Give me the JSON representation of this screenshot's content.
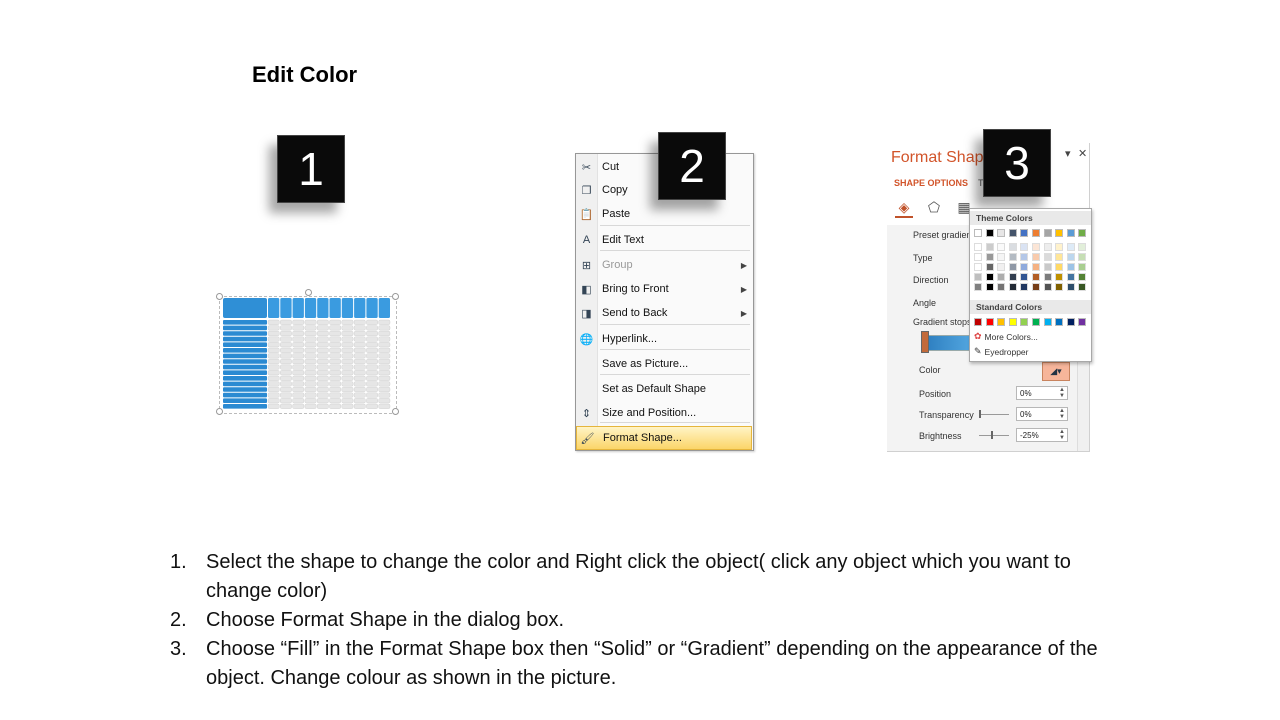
{
  "title": "Edit Color",
  "steps": [
    {
      "number": "1",
      "badge": "1"
    },
    {
      "number": "2",
      "badge": "2"
    },
    {
      "number": "3",
      "badge": "3"
    }
  ],
  "context_menu": {
    "items": [
      {
        "label": "Cut",
        "icon": "scissors-icon",
        "glyph": "✂",
        "disabled": false,
        "submenu": false
      },
      {
        "label": "Copy",
        "icon": "copy-icon",
        "glyph": "❐",
        "disabled": false,
        "submenu": false
      },
      {
        "label": "Paste",
        "icon": "paste-icon",
        "glyph": "📋",
        "disabled": false,
        "submenu": false
      },
      {
        "label": "Edit Text",
        "icon": "edit-text-icon",
        "glyph": "A",
        "disabled": false,
        "submenu": false
      },
      {
        "label": "Group",
        "icon": "group-icon",
        "glyph": "⊞",
        "disabled": true,
        "submenu": true
      },
      {
        "label": "Bring to Front",
        "icon": "bring-to-front-icon",
        "glyph": "◧",
        "disabled": false,
        "submenu": true
      },
      {
        "label": "Send to Back",
        "icon": "send-to-back-icon",
        "glyph": "◨",
        "disabled": false,
        "submenu": true
      },
      {
        "label": "Hyperlink...",
        "icon": "hyperlink-icon",
        "glyph": "🌐",
        "disabled": false,
        "submenu": false
      },
      {
        "label": "Save as Picture...",
        "icon": "",
        "glyph": "",
        "disabled": false,
        "submenu": false
      },
      {
        "label": "Set as Default Shape",
        "icon": "",
        "glyph": "",
        "disabled": false,
        "submenu": false
      },
      {
        "label": "Size and Position...",
        "icon": "size-position-icon",
        "glyph": "⇕",
        "disabled": false,
        "submenu": false
      },
      {
        "label": "Format Shape...",
        "icon": "format-shape-icon",
        "glyph": "🖌",
        "disabled": false,
        "submenu": false
      }
    ]
  },
  "format_pane": {
    "title": "Format Shap",
    "tab_shape": "SHAPE OPTIONS",
    "tab_text": "T",
    "labels": {
      "preset": "Preset gradien",
      "type": "Type",
      "direction": "Direction",
      "angle": "Angle",
      "gradient_stops": "Gradient stops",
      "color": "Color",
      "position": "Position",
      "transparency": "Transparency",
      "brightness": "Brightness"
    },
    "values": {
      "position": "0%",
      "transparency": "0%",
      "brightness": "-25%"
    },
    "palette": {
      "theme_header": "Theme Colors",
      "standard_header": "Standard Colors",
      "more_colors": "More Colors...",
      "eyedropper": "Eyedropper",
      "theme_colors": [
        "#ffffff",
        "#000000",
        "#e7e6e6",
        "#44546a",
        "#4472c4",
        "#ed7d31",
        "#a5a5a5",
        "#ffc000",
        "#5b9bd5",
        "#70ad47"
      ],
      "standard_colors": [
        "#c00000",
        "#ff0000",
        "#ffc000",
        "#ffff00",
        "#92d050",
        "#00b050",
        "#00b0f0",
        "#0070c0",
        "#002060",
        "#7030a0"
      ]
    }
  },
  "instructions": [
    {
      "num": "1.",
      "text": "Select the shape to change the color and Right click the object( click any object which you want to change color)"
    },
    {
      "num": "2.",
      "text": "Choose Format Shape in the dialog box."
    },
    {
      "num": "3.",
      "text": "Choose “Fill” in the Format Shape box then “Solid” or “Gradient” depending on the appearance of the object. Change colour as shown in the picture."
    }
  ]
}
